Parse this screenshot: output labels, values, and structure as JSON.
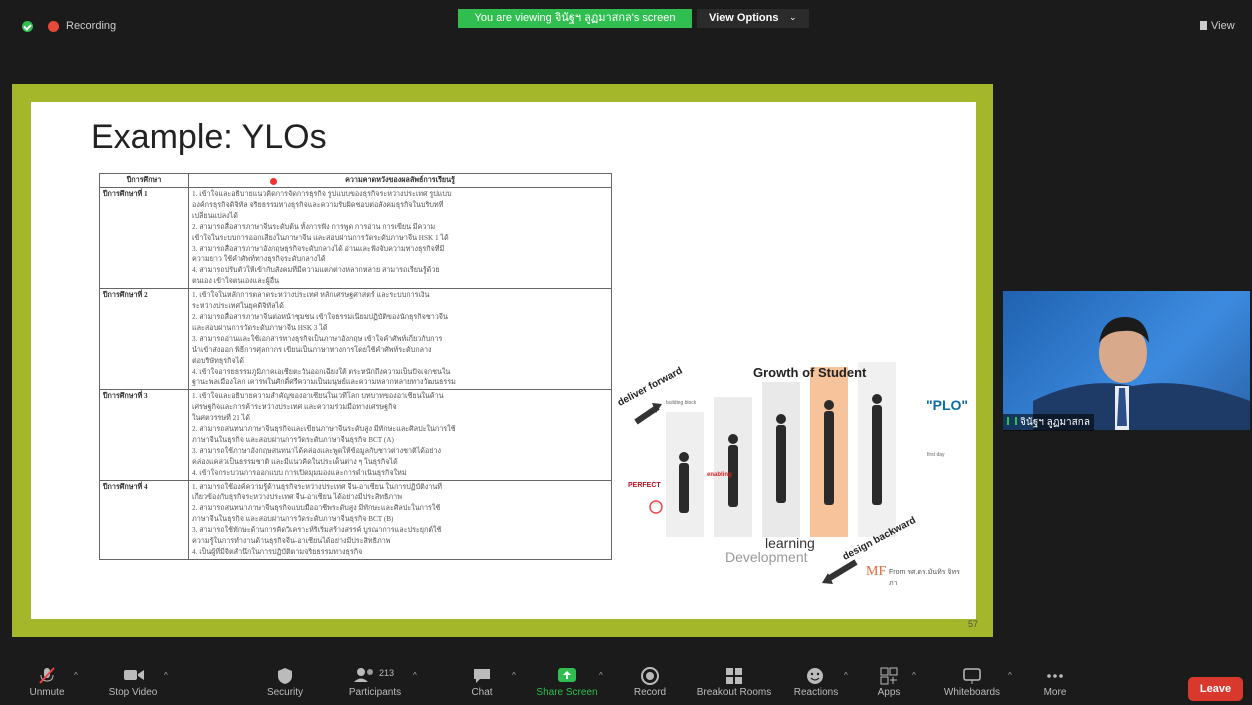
{
  "topbar": {
    "recording_label": "Recording",
    "viewing_banner": "You are viewing จินัฐฯ ลูฏมาสกล's screen",
    "view_options_label": "View Options",
    "view_label": "View"
  },
  "slide": {
    "title": "Example: YLOs",
    "table": {
      "headers": [
        "ปีการศึกษา",
        "ความคาดหวังของผลลัพธ์การเรียนรู้"
      ],
      "rows": [
        {
          "year": "ปีการศึกษาที่ 1",
          "lines": [
            "1. เข้าใจและอธิบายแนวคิดการจัดการธุรกิจ รูปแบบของธุรกิจระหว่างประเทศ รูปแบบ",
            "องค์กรธุรกิจดิจิทัล จริยธรรมทางธุรกิจและความรับผิดชอบต่อสังคมธุรกิจในบริบทที่",
            "เปลี่ยนแปลงได้",
            "2. สามารถสื่อสารภาษาจีนระดับต้น ทั้งการฟัง การพูด การอ่าน การเขียน มีความ",
            "เข้าใจในระบบการออกเสียงในภาษาจีน และสอบผ่านการวัดระดับภาษาจีน HSK 1 ได้",
            "3. สามารถสื่อสารภาษาอังกฤษธุรกิจระดับกลางได้ อ่านและฟังจับความทางธุรกิจที่มี",
            "ความยาว ใช้คำศัพท์ทางธุรกิจระดับกลางได้",
            "4. สามารถปรับตัวให้เข้ากับสังคมที่มีความแตกต่างหลากหลาย สามารถเรียนรู้ด้วย",
            "ตนเอง เข้าใจตนเองและผู้อื่น"
          ]
        },
        {
          "year": "ปีการศึกษาที่ 2",
          "lines": [
            "1. เข้าใจในหลักการตลาดระหว่างประเทศ หลักเศรษฐศาสตร์ และระบบการเงิน",
            "ระหว่างประเทศในยุคดิจิทัลได้",
            "2. สามารถสื่อสารภาษาจีนต่อหน้าชุมชน เข้าใจธรรมเนียมปฏิบัติของนักธุรกิจชาวจีน",
            "และสอบผ่านการวัดระดับภาษาจีน HSK 3 ได้",
            "3. สามารถอ่านและใช้เอกสารทางธุรกิจเป็นภาษาอังกฤษ เข้าใจคำศัพท์เกี่ยวกับการ",
            "นำเข้าส่งออก พิธีการศุลกากร เขียนเป็นภาษาทางการโดยใช้คำศัพท์ระดับกลาง",
            "ต่อบริษัทธุรกิจได้",
            "4. เข้าใจอารยธรรมภูมิภาคเอเชียตะวันออกเฉียงใต้ ตระหนักถึงความเป็นปัจเจกชนใน",
            "ฐานะพลเมืองโลก เคารพในศักดิ์ศรีความเป็นมนุษย์และความหลากหลายทางวัฒนธรรม"
          ]
        },
        {
          "year": "ปีการศึกษาที่ 3",
          "lines": [
            "1. เข้าใจและอธิบายความสำคัญของอาเซียนในเวทีโลก บทบาทของอาเซียนในด้าน",
            "เศรษฐกิจและการค้าระหว่างประเทศ และความร่วมมือทางเศรษฐกิจ",
            "ในศตวรรษที่ 21 ได้",
            "2. สามารถสนทนาภาษาจีนธุรกิจและเขียนภาษาจีนระดับสูง มีทักษะและศิลปะในการใช้",
            "ภาษาจีนในธุรกิจ และสอบผ่านการวัดระดับภาษาจีนธุรกิจ BCT (A)",
            "3. สามารถใช้ภาษาอังกฤษสนทนาได้คล่องและพูดให้ข้อมูลกับชาวต่างชาติได้อย่าง",
            "คล่องแคล่วเป็นธรรมชาติ และมีแนวคิดในประเด็นต่าง ๆ ในธุรกิจได้",
            "4. เข้าใจกระบวนการออกแบบ การเปิดมุมมองและการดำเนินธุรกิจใหม่"
          ]
        },
        {
          "year": "ปีการศึกษาที่ 4",
          "lines": [
            "1. สามารถใช้องค์ความรู้ด้านธุรกิจระหว่างประเทศ จีน-อาเซียน ในการปฏิบัติงานที่",
            "เกี่ยวข้องกับธุรกิจระหว่างประเทศ จีน-อาเซียน ได้อย่างมีประสิทธิภาพ",
            "2. สามารถสนทนาภาษาจีนธุรกิจแบบมืออาชีพระดับสูง มีทักษะและศิลปะในการใช้",
            "ภาษาจีนในธุรกิจ และสอบผ่านการวัดระดับภาษาจีนธุรกิจ BCT (B)",
            "3. สามารถใช้ทักษะด้านการคิดวิเคราะห์ริเริ่มสร้างสรรค์ บูรณาการและประยุกต์ใช้",
            "ความรู้ในการทำงานด้านธุรกิจจีน-อาเซียนได้อย่างมีประสิทธิภาพ",
            "4. เป็นผู้ที่มีจิตสำนึกในการปฏิบัติตามจริยธรรมทางธุรกิจ"
          ]
        }
      ]
    },
    "graphic": {
      "title": "Growth of Student",
      "deliver": "deliver forward",
      "design": "design backward",
      "plo": "\"PLO\"",
      "learning": "learning",
      "development": "Development",
      "perfect": "PERFECT",
      "enabling": "enabling",
      "building_block": "building block",
      "first_day": "first day",
      "from": "From รศ.ดร.มันทิร จิทรภา"
    },
    "slide_number": "57"
  },
  "video": {
    "participant_name": "จินัฐฯ ลูฏมาสกล"
  },
  "toolbar": {
    "unmute": "Unmute",
    "stop_video": "Stop Video",
    "security": "Security",
    "participants": "Participants",
    "participant_count": "213",
    "chat": "Chat",
    "share_screen": "Share Screen",
    "record": "Record",
    "breakout": "Breakout Rooms",
    "reactions": "Reactions",
    "apps": "Apps",
    "whiteboards": "Whiteboards",
    "more": "More",
    "leave": "Leave"
  },
  "colors": {
    "share_green": "#2fbe4f",
    "frame_olive": "#a4b62a",
    "leave_red": "#d9382c"
  }
}
